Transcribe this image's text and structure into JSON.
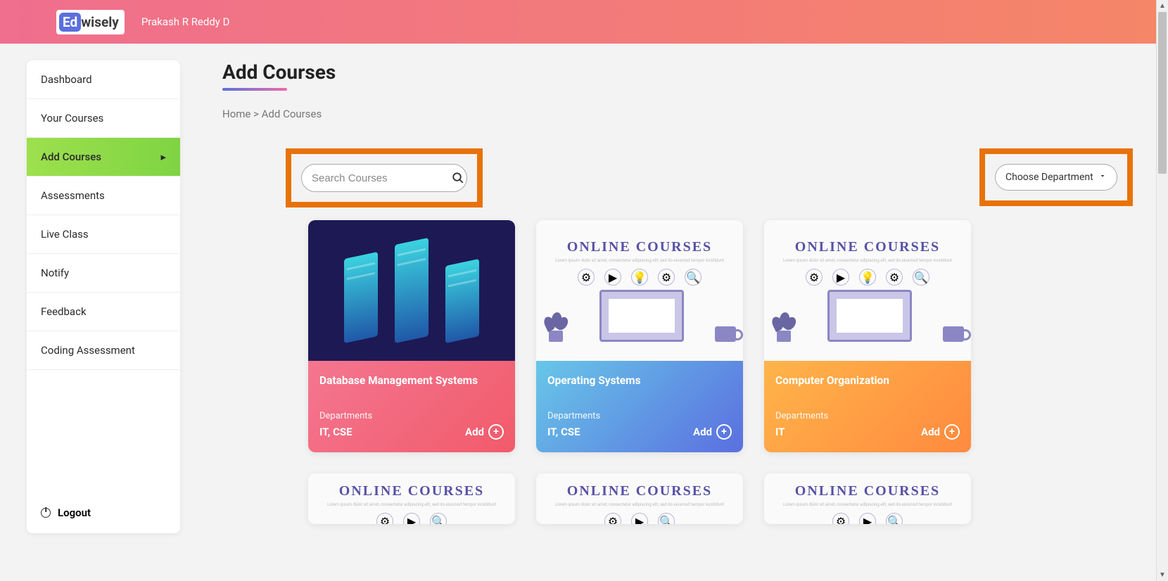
{
  "header": {
    "logo_prefix": "Ed",
    "logo_suffix": "wisely",
    "user": "Prakash R Reddy D"
  },
  "sidebar": {
    "items": [
      {
        "label": "Dashboard",
        "active": false
      },
      {
        "label": "Your Courses",
        "active": false
      },
      {
        "label": "Add Courses",
        "active": true
      },
      {
        "label": "Assessments",
        "active": false
      },
      {
        "label": "Live Class",
        "active": false
      },
      {
        "label": "Notify",
        "active": false
      },
      {
        "label": "Feedback",
        "active": false
      },
      {
        "label": "Coding Assessment",
        "active": false
      }
    ],
    "logout": "Logout"
  },
  "page": {
    "title": "Add Courses",
    "breadcrumb": "Home > Add Courses"
  },
  "search": {
    "placeholder": "Search Courses"
  },
  "department_select": {
    "label": "Choose Department"
  },
  "illustration": {
    "online_label": "ONLINE COURSES",
    "lorem": "Lorem ipsum dolor sit amet, consectetur adipiscing elit, sed do eiusmod tempor incididunt"
  },
  "cards": [
    {
      "title": "Database Management Systems",
      "dept_label": "Departments",
      "departments": "IT, CSE",
      "add_label": "Add",
      "image": "dark",
      "grad": "pink"
    },
    {
      "title": "Operating Systems",
      "dept_label": "Departments",
      "departments": "IT, CSE",
      "add_label": "Add",
      "image": "light",
      "grad": "blue"
    },
    {
      "title": "Computer Organization",
      "dept_label": "Departments",
      "departments": "IT",
      "add_label": "Add",
      "image": "light",
      "grad": "orange"
    }
  ]
}
